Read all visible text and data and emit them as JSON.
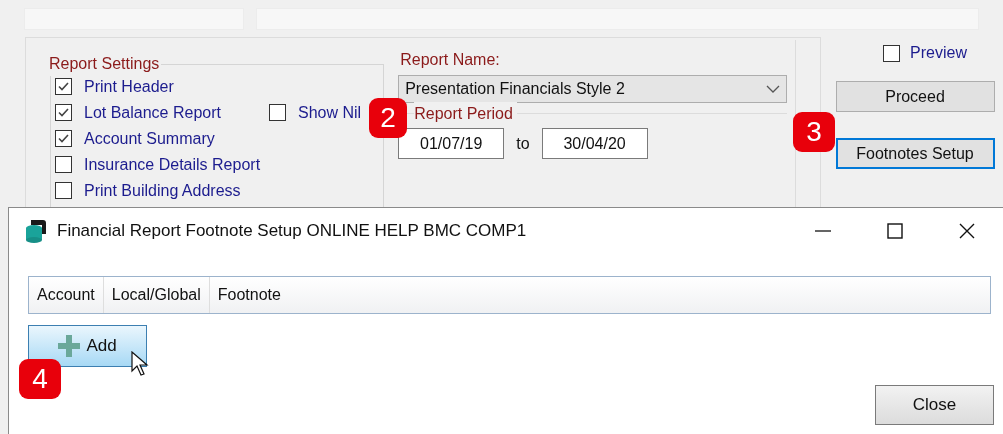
{
  "report_settings": {
    "title": "Report Settings",
    "options": [
      {
        "label": "Print Header",
        "checked": true
      },
      {
        "label": "Lot Balance Report",
        "checked": true
      },
      {
        "label": "Account Summary",
        "checked": true
      },
      {
        "label": "Insurance Details Report",
        "checked": false
      },
      {
        "label": "Print Building Address",
        "checked": false
      }
    ],
    "show_nil": {
      "label": "Show Nil",
      "checked": false
    }
  },
  "report_name": {
    "label": "Report Name:",
    "value": "Presentation Financials Style 2"
  },
  "report_period": {
    "title": "Report Period",
    "from": "01/07/19",
    "separator": "to",
    "to": "30/04/20"
  },
  "preview": {
    "label": "Preview",
    "checked": false
  },
  "buttons": [
    {
      "label": "Proceed",
      "focused": false
    },
    {
      "label": "Footnotes Setup",
      "focused": true
    }
  ],
  "dialog": {
    "title": "Financial Report Footnote Setup ONLINE HELP BMC COMP1",
    "columns": [
      "Account",
      "Local/Global",
      "Footnote"
    ],
    "add_button": "Add",
    "close_button": "Close"
  },
  "callouts": [
    "2",
    "3",
    "4"
  ]
}
